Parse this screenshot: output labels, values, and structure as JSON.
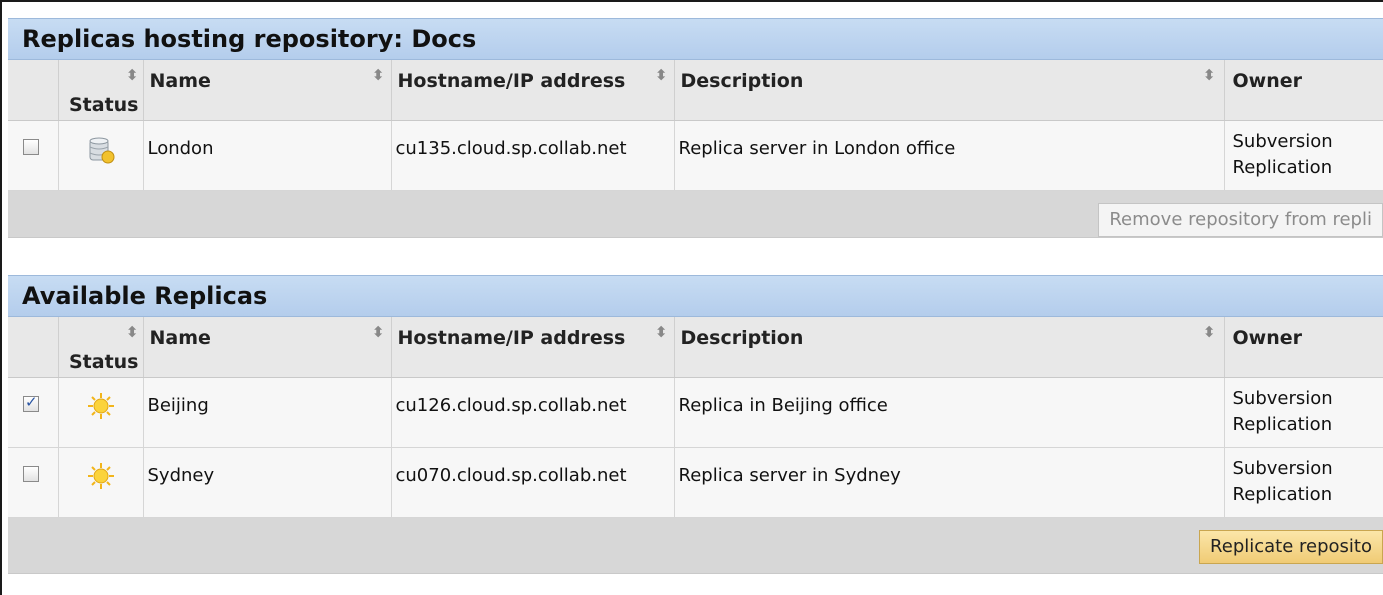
{
  "hosting": {
    "title": "Replicas hosting repository: Docs",
    "columns": {
      "status": "Status",
      "name": "Name",
      "host": "Hostname/IP address",
      "description": "Description",
      "owner": "Owner"
    },
    "rows": [
      {
        "checked": false,
        "status_icon": "database-icon",
        "name": "London",
        "host": "cu135.cloud.sp.collab.net",
        "description": "Replica server in London office",
        "owner_line1": "Subversion",
        "owner_line2": "Replication"
      }
    ],
    "button_label": "Remove repository from repli"
  },
  "available": {
    "title": "Available Replicas",
    "columns": {
      "status": "Status",
      "name": "Name",
      "host": "Hostname/IP address",
      "description": "Description",
      "owner": "Owner"
    },
    "rows": [
      {
        "checked": true,
        "status_icon": "sun-icon",
        "name": "Beijing",
        "host": "cu126.cloud.sp.collab.net",
        "description": "Replica in Beijing office",
        "owner_line1": "Subversion",
        "owner_line2": "Replication"
      },
      {
        "checked": false,
        "status_icon": "sun-icon",
        "name": "Sydney",
        "host": "cu070.cloud.sp.collab.net",
        "description": "Replica server in Sydney",
        "owner_line1": "Subversion",
        "owner_line2": "Replication"
      }
    ],
    "button_label": "Replicate reposito"
  }
}
